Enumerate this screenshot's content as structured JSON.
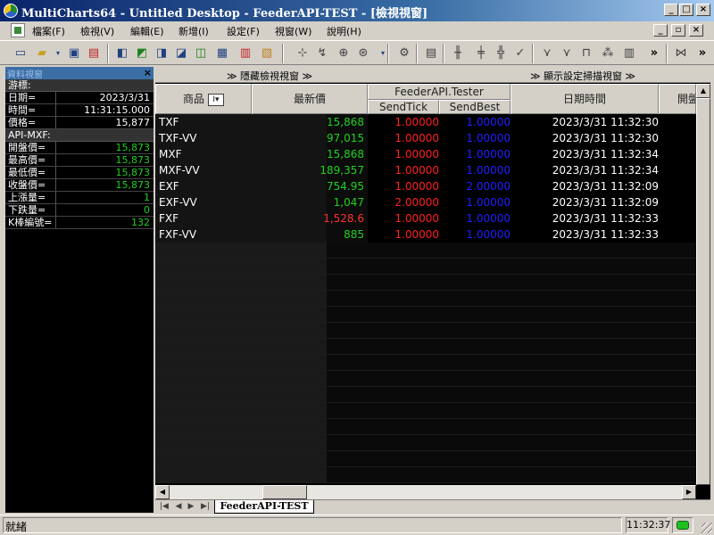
{
  "window": {
    "title": "MultiCharts64 - Untitled Desktop - FeederAPI-TEST - [檢視視窗]",
    "minimize": "_",
    "maximize": "□",
    "close": "×"
  },
  "menu": [
    "檔案(F)",
    "檢視(V)",
    "編輯(E)",
    "新增(I)",
    "設定(F)",
    "視窗(W)",
    "說明(H)"
  ],
  "left_panel": {
    "title": "資料視窗",
    "cursor_section": "游標:",
    "cursor_rows": [
      {
        "label": "日期=",
        "value": "2023/3/31"
      },
      {
        "label": "時間=",
        "value": "11:31:15.000"
      },
      {
        "label": "價格=",
        "value": "15,877"
      }
    ],
    "symbol_section": "API-MXF:",
    "symbol_rows": [
      {
        "label": "開盤價=",
        "value": "15,873"
      },
      {
        "label": "最高價=",
        "value": "15,873"
      },
      {
        "label": "最低價=",
        "value": "15,873"
      },
      {
        "label": "收盤價=",
        "value": "15,873"
      },
      {
        "label": "上漲量=",
        "value": "1"
      },
      {
        "label": "下跌量=",
        "value": "0"
      },
      {
        "label": "K棒編號=",
        "value": "132"
      }
    ]
  },
  "main": {
    "hide_label": "≫ 隱藏檢視視窗 ≫",
    "show_label": "≫ 顯示設定掃描視窗 ≫",
    "headers": {
      "symbol": "商品",
      "sort_btn": "I▾",
      "last": "最新價",
      "group": "FeederAPI.Tester",
      "send_tick": "SendTick",
      "send_best": "SendBest",
      "datetime": "日期時間",
      "open": "開盤"
    },
    "rows": [
      {
        "symbol": "TXF",
        "last": "15,868",
        "tick": "1.00000",
        "best": "1.00000",
        "time": "2023/3/31 11:32:30"
      },
      {
        "symbol": "TXF-VV",
        "last": "97,015",
        "tick": "1.00000",
        "best": "1.00000",
        "time": "2023/3/31 11:32:30"
      },
      {
        "symbol": "MXF",
        "last": "15,868",
        "tick": "1.00000",
        "best": "1.00000",
        "time": "2023/3/31 11:32:34"
      },
      {
        "symbol": "MXF-VV",
        "last": "189,357",
        "tick": "1.00000",
        "best": "1.00000",
        "time": "2023/3/31 11:32:34"
      },
      {
        "symbol": "EXF",
        "last": "754.95",
        "tick": "1.00000",
        "best": "2.00000",
        "time": "2023/3/31 11:32:09"
      },
      {
        "symbol": "EXF-VV",
        "last": "1,047",
        "tick": "2.00000",
        "best": "1.00000",
        "time": "2023/3/31 11:32:09"
      },
      {
        "symbol": "FXF",
        "last": "1,528.6",
        "tick": "1.00000",
        "best": "1.00000",
        "time": "2023/3/31 11:32:33"
      },
      {
        "symbol": "FXF-VV",
        "last": "885",
        "tick": "1.00000",
        "best": "1.00000",
        "time": "2023/3/31 11:32:33"
      }
    ],
    "sheet_tab": "FeederAPI-TEST"
  },
  "colors": {
    "last_up": "#20d020",
    "last_down": "#ff3030",
    "tick": "#ff2020",
    "best": "#2020ff"
  },
  "status": {
    "text": "就緒",
    "time": "11:32:37"
  }
}
